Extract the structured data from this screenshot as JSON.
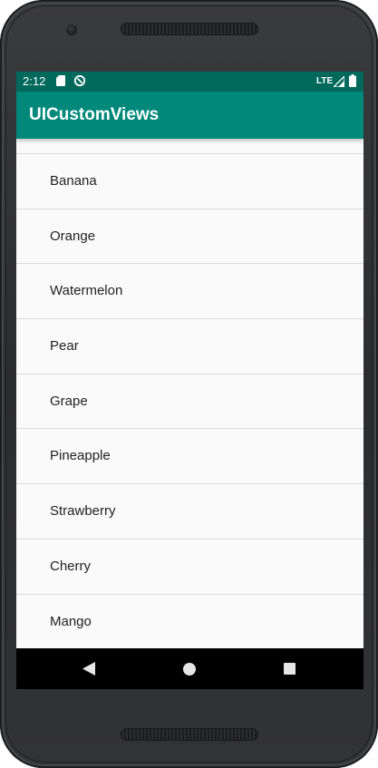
{
  "status_bar": {
    "time": "2:12",
    "network": "LTE",
    "icons": [
      "sd-card-icon",
      "sync-icon",
      "signal-icon",
      "battery-icon"
    ],
    "background_color": "#00695c"
  },
  "app_bar": {
    "title": "UICustomViews",
    "background_color": "#00897b"
  },
  "list": {
    "items": [
      {
        "label": "Banana"
      },
      {
        "label": "Orange"
      },
      {
        "label": "Watermelon"
      },
      {
        "label": "Pear"
      },
      {
        "label": "Grape"
      },
      {
        "label": "Pineapple"
      },
      {
        "label": "Strawberry"
      },
      {
        "label": "Cherry"
      },
      {
        "label": "Mango"
      }
    ]
  },
  "nav_bar": {
    "icons": [
      "back-icon",
      "home-icon",
      "recents-icon"
    ]
  }
}
